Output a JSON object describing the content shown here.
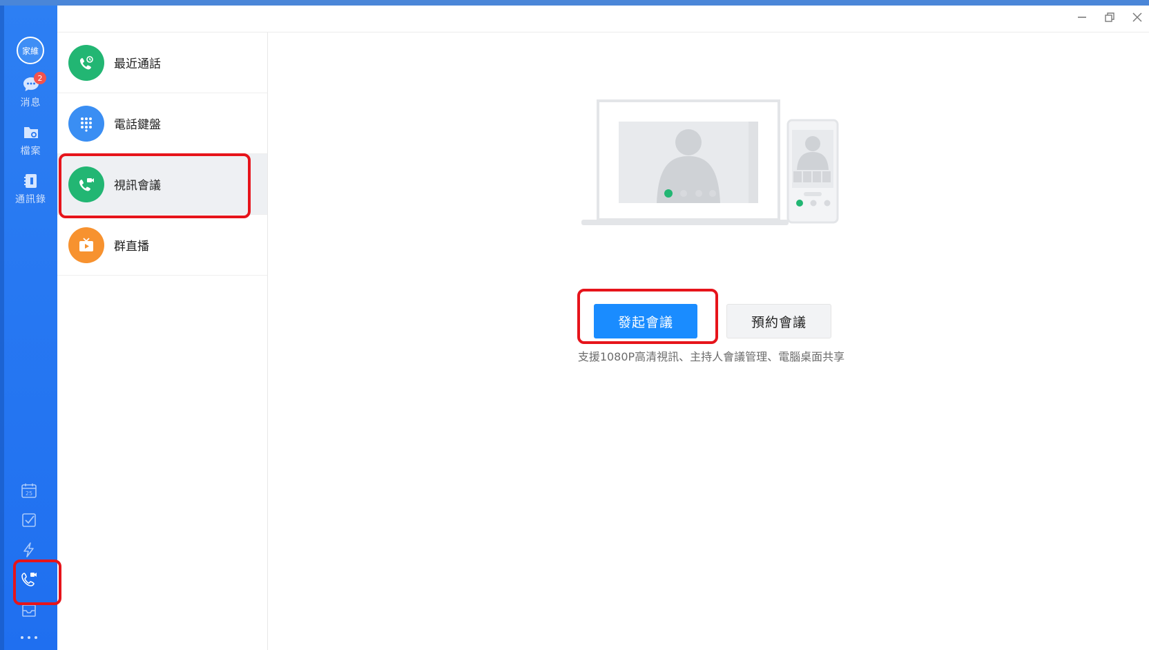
{
  "rail": {
    "avatar_text": "家維",
    "items": [
      {
        "label": "消息",
        "icon": "chat-bubble-icon",
        "badge": "2"
      },
      {
        "label": "檔案",
        "icon": "folder-icon"
      },
      {
        "label": "通訊錄",
        "icon": "contacts-book-icon"
      }
    ],
    "bottom_icons": [
      "calendar-icon",
      "checkbox-task-icon",
      "lightning-icon",
      "video-call-icon",
      "mail-icon",
      "more-dots-icon"
    ],
    "calendar_day": "25"
  },
  "menu": {
    "items": [
      {
        "label": "最近通話",
        "icon": "recent-call-icon",
        "color": "#22b673"
      },
      {
        "label": "電話鍵盤",
        "icon": "dialpad-icon",
        "color": "#3a8ef3"
      },
      {
        "label": "視訊會議",
        "icon": "video-meeting-icon",
        "color": "#22b673",
        "active": true
      },
      {
        "label": "群直播",
        "icon": "live-tv-icon",
        "color": "#f7922f"
      }
    ]
  },
  "main": {
    "start_meeting_label": "發起會議",
    "schedule_meeting_label": "預約會議",
    "tagline": "支援1080P高清視訊、主持人會議管理、電腦桌面共享"
  },
  "colors": {
    "rail": "#2179f2",
    "primary_button": "#1a8cff",
    "highlight_box": "#e6141b"
  }
}
